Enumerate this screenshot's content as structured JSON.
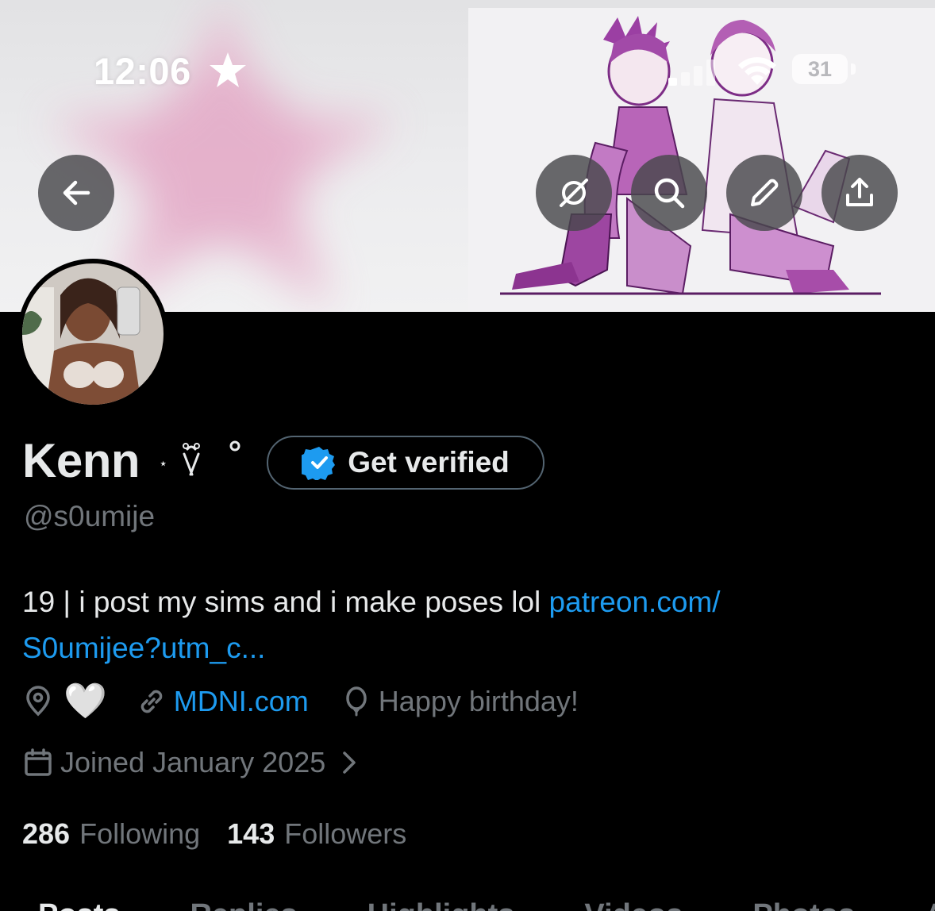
{
  "status_bar": {
    "time": "12:06",
    "battery": "31"
  },
  "header": {
    "icons": [
      "back-arrow-icon",
      "grok-icon",
      "search-icon",
      "pencil-icon",
      "share-icon"
    ]
  },
  "profile": {
    "name": "Kenn",
    "get_verified_label": "Get verified",
    "handle": "@s0umije",
    "bio_text": "19 | i post my sims and i make poses lol ",
    "bio_link_line1": "patreon.com/",
    "bio_link_line2": "S0umijee?utm_c...",
    "location": "🤍",
    "website": "MDNI.com",
    "birthday": "Happy birthday!",
    "joined": "Joined January 2025",
    "following_count": "286",
    "following_label": "Following",
    "followers_count": "143",
    "followers_label": "Followers"
  },
  "tabs": [
    "Posts",
    "Replies",
    "Highlights",
    "Videos",
    "Photos",
    "Articles"
  ],
  "colors": {
    "background": "#000000",
    "text_primary": "#e7e9ea",
    "text_secondary": "#71767b",
    "link": "#1d9bf0",
    "verified_badge": "#1d9bf0"
  }
}
